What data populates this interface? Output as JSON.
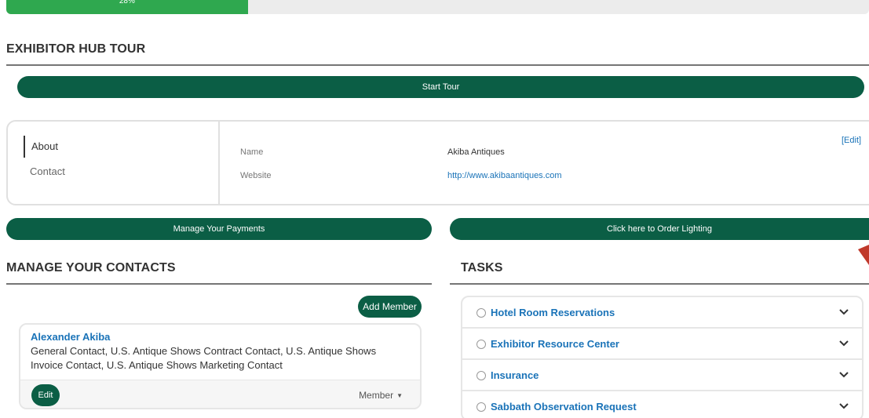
{
  "progress": {
    "percent": 28,
    "label": "28%"
  },
  "tour": {
    "title": "EXHIBITOR HUB TOUR",
    "start_label": "Start Tour"
  },
  "profile": {
    "tabs": [
      {
        "label": "About"
      },
      {
        "label": "Contact"
      }
    ],
    "fields": [
      {
        "label": "Name",
        "value": "Akiba Antiques"
      },
      {
        "label": "Website",
        "value": "http://www.akibaantiques.com"
      }
    ],
    "edit_label": "[Edit]"
  },
  "actions": {
    "payments_label": "Manage Your Payments",
    "lighting_label": "Click here to Order Lighting"
  },
  "contacts": {
    "title": "MANAGE YOUR CONTACTS",
    "add_label": "Add Member",
    "items": [
      {
        "name": "Alexander Akiba",
        "roles": "General Contact, U.S. Antique Shows Contract Contact, U.S. Antique Shows Invoice Contact, U.S. Antique Shows Marketing Contact",
        "edit_label": "Edit",
        "role_select": "Member"
      }
    ]
  },
  "tasks": {
    "title": "TASKS",
    "items": [
      {
        "label": "Hotel Room Reservations"
      },
      {
        "label": "Exhibitor Resource Center"
      },
      {
        "label": "Insurance"
      },
      {
        "label": "Sabbath Observation Request"
      }
    ]
  },
  "colors": {
    "primary": "#0b5e45",
    "progress": "#2fa84f",
    "link": "#1a73b8"
  }
}
